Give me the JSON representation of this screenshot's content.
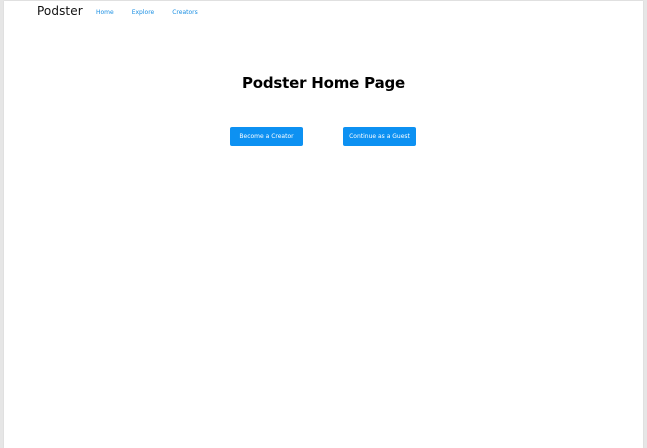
{
  "header": {
    "brand": "Podster",
    "nav": [
      {
        "label": "Home"
      },
      {
        "label": "Explore"
      },
      {
        "label": "Creators"
      }
    ]
  },
  "main": {
    "title": "Podster Home Page",
    "buttons": {
      "creator": "Become a Creator",
      "guest": "Continue as a Guest"
    }
  },
  "colors": {
    "accent": "#0d91f2",
    "link": "#1a8fe3",
    "background": "#ffffff"
  }
}
